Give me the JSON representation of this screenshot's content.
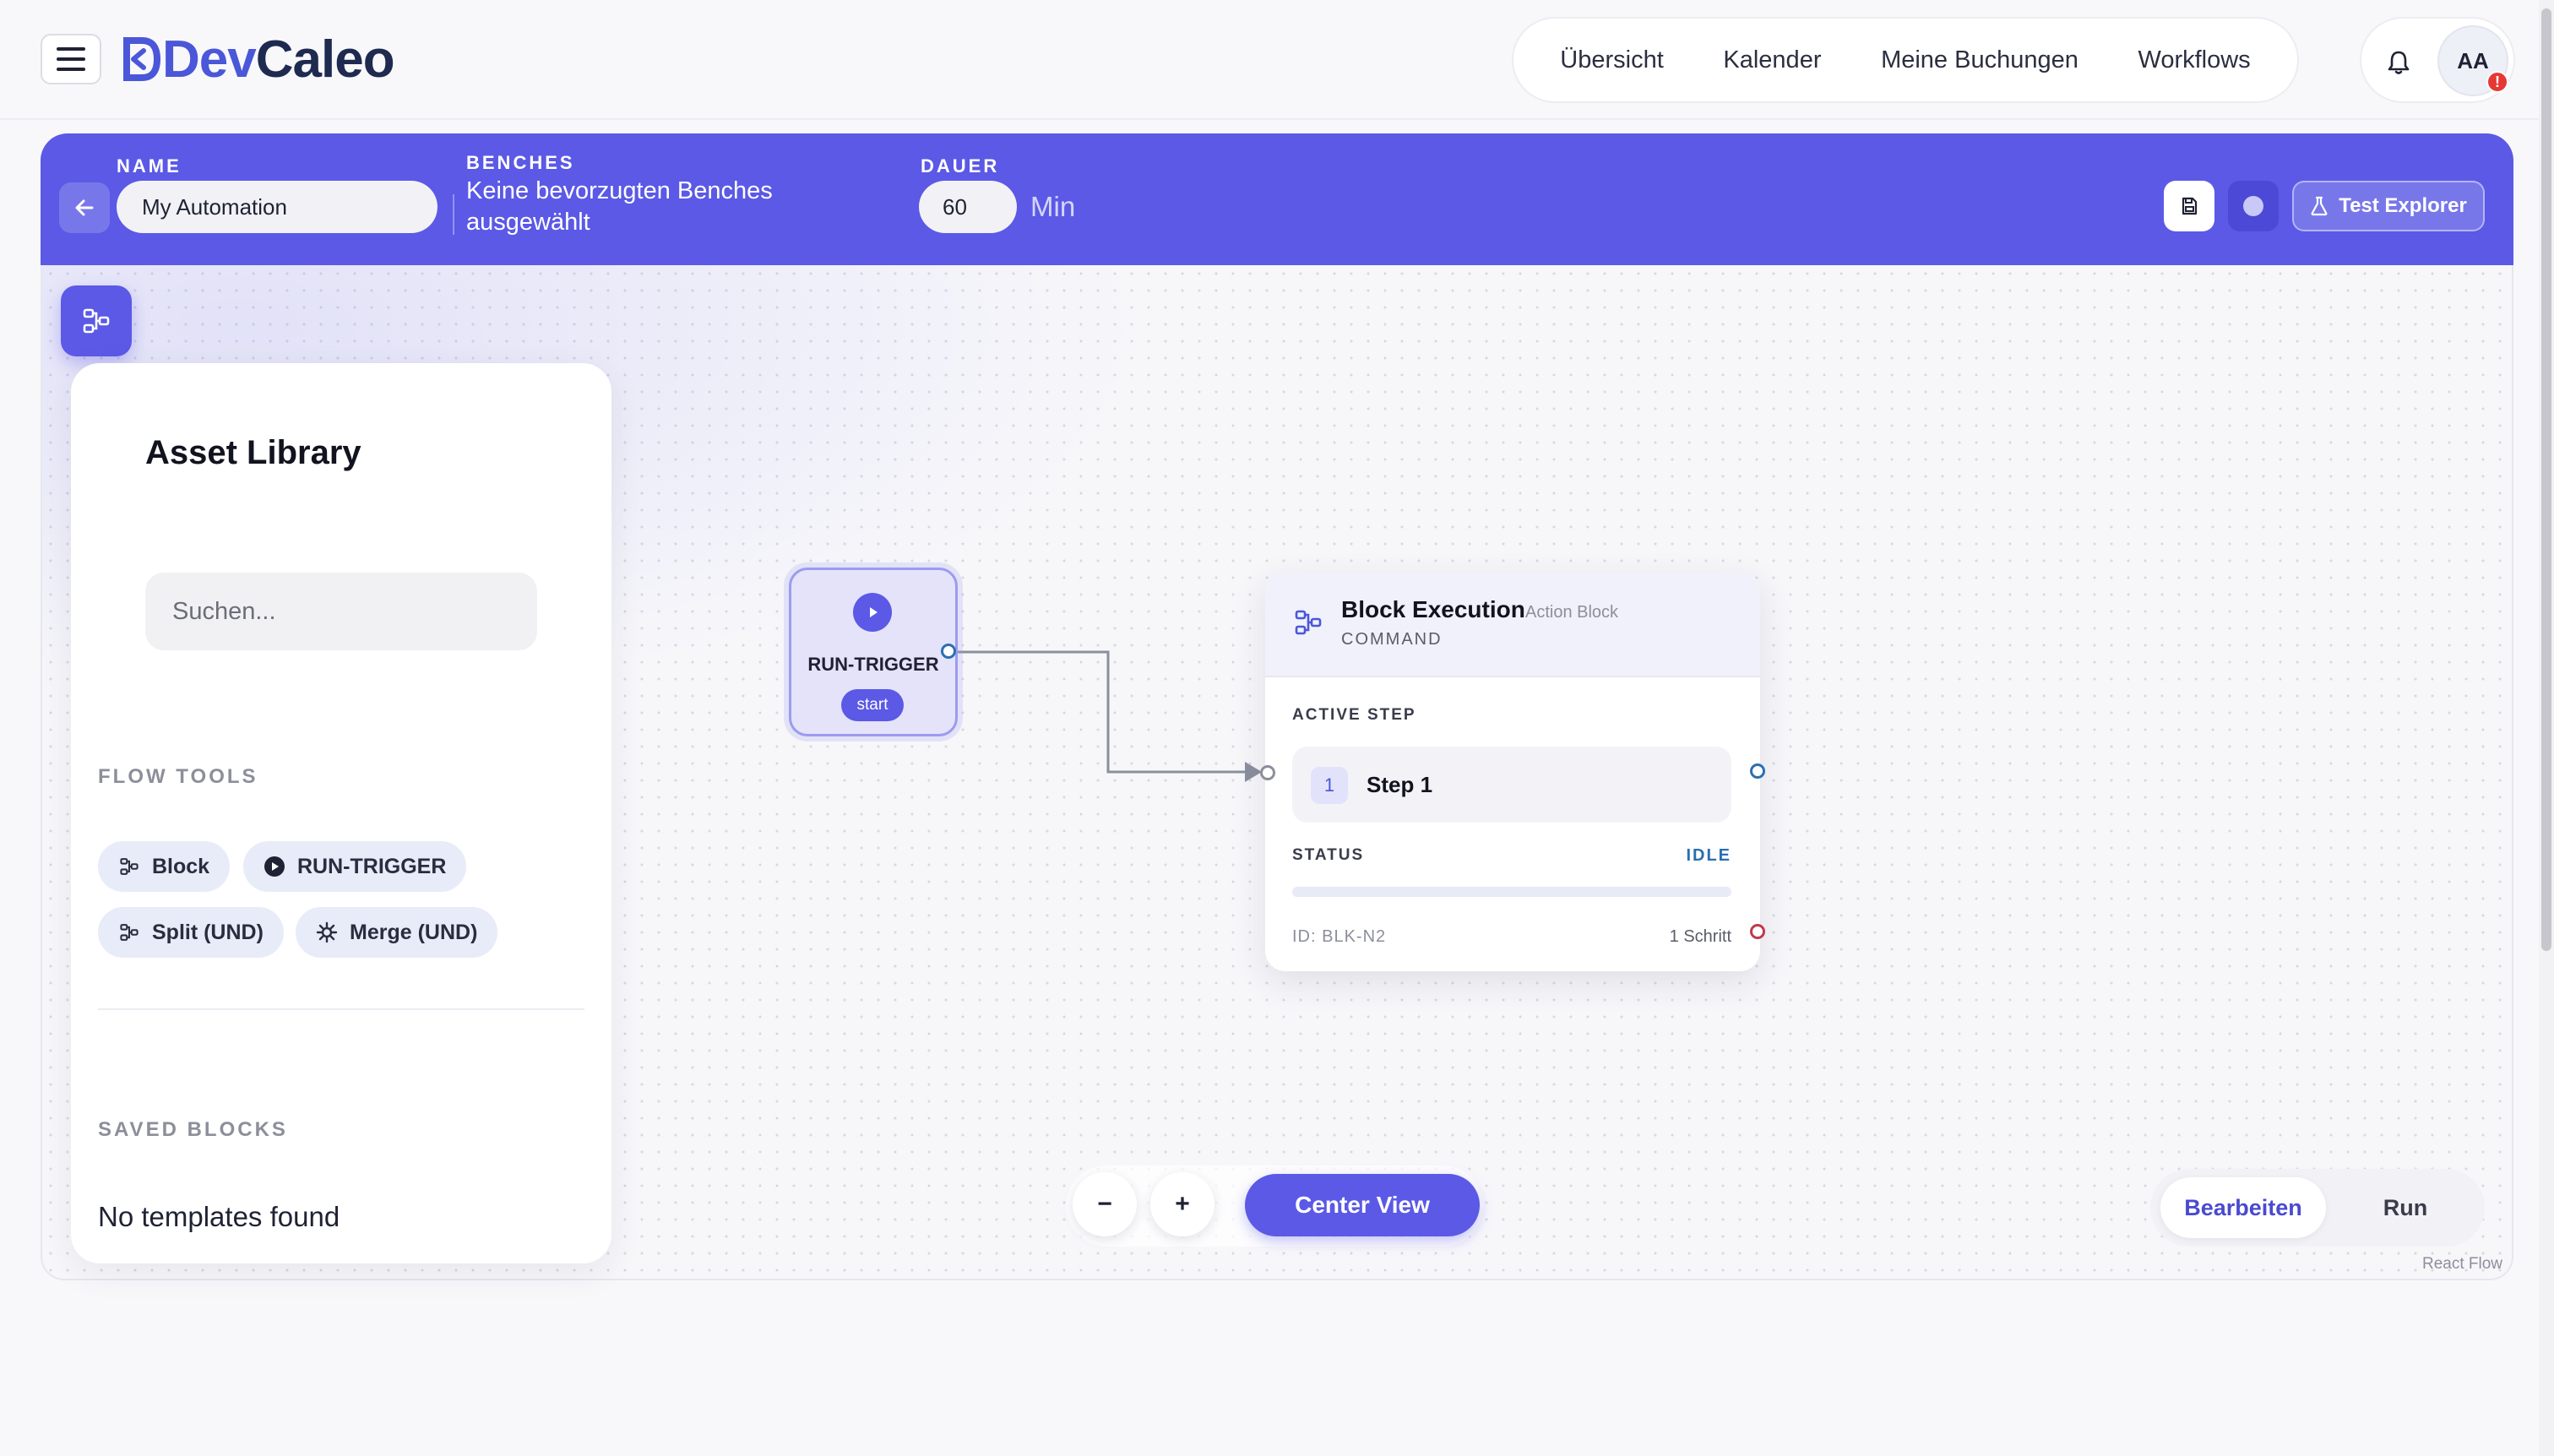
{
  "app": {
    "logo_prefix": "Dev",
    "logo_suffix": "Caleo"
  },
  "nav": {
    "items": [
      "Übersicht",
      "Kalender",
      "Meine Buchungen",
      "Workflows"
    ]
  },
  "user": {
    "initials": "AA",
    "badge": "!"
  },
  "header": {
    "name_label": "NAME",
    "name_value": "My Automation",
    "benches_label": "BENCHES",
    "benches_value": "Keine bevorzugten Benches ausgewählt",
    "dauer_label": "DAUER",
    "dauer_value": "60",
    "dauer_unit": "Min",
    "test_explorer": "Test Explorer"
  },
  "library": {
    "title": "Asset Library",
    "search_placeholder": "Suchen...",
    "flow_tools_label": "FLOW TOOLS",
    "tools": [
      "Block",
      "RUN-TRIGGER",
      "Split (UND)",
      "Merge (UND)"
    ],
    "saved_blocks_label": "SAVED BLOCKS",
    "empty_text": "No templates found"
  },
  "trigger_node": {
    "label": "RUN-TRIGGER",
    "tag": "start"
  },
  "block_node": {
    "title": "Block Execution",
    "subtitle": "Action Block",
    "type": "COMMAND",
    "active_step_label": "ACTIVE STEP",
    "step_number": "1",
    "step_name": "Step 1",
    "status_label": "STATUS",
    "status_value": "IDLE",
    "progress": 0,
    "id_text": "ID: BLK-N2",
    "step_count": "1 Schritt"
  },
  "controls": {
    "zoom_out": "−",
    "zoom_in": "+",
    "center_view": "Center View",
    "mode_edit": "Bearbeiten",
    "mode_run": "Run",
    "attribution": "React Flow"
  },
  "colors": {
    "accent": "#5b59e6",
    "brand_dark": "#1e2a4f",
    "status_idle": "#2a6fb0",
    "error": "#e53935"
  }
}
